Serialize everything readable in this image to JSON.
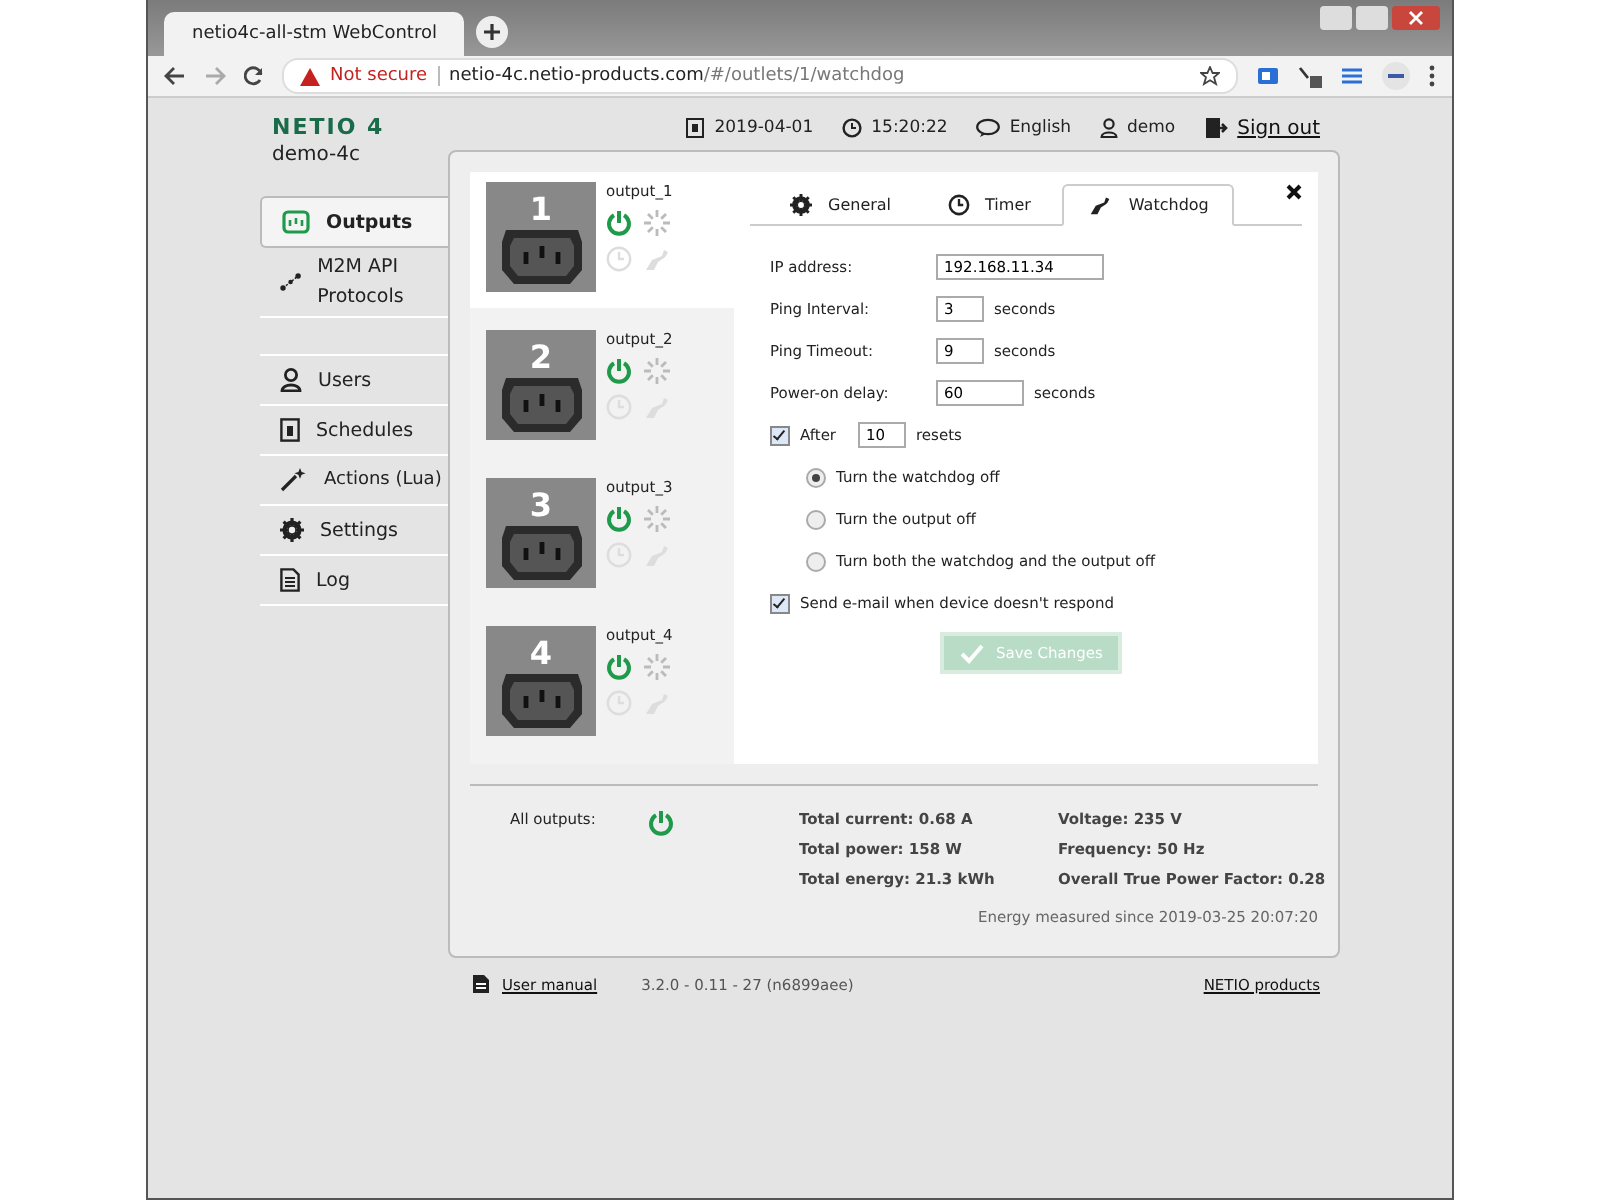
{
  "browser": {
    "tab_title": "netio4c-all-stm WebControl",
    "security": "Not secure",
    "host": "netio-4c.netio-products.com",
    "path": "/#/outlets/1/watchdog"
  },
  "header": {
    "logo": "NETIO 4",
    "device": "demo-4c",
    "date": "2019-04-01",
    "time": "15:20:22",
    "language": "English",
    "user": "demo",
    "sign_out": "Sign out"
  },
  "sidebar": {
    "items": [
      {
        "label": "Outputs",
        "kind": "outputs",
        "selected": true
      },
      {
        "label": "M2M API Protocols",
        "kind": "m2m",
        "selected": false
      },
      {
        "label": "Users",
        "kind": "users",
        "selected": false
      },
      {
        "label": "Schedules",
        "kind": "schedules",
        "selected": false
      },
      {
        "label": "Actions (Lua)",
        "kind": "actions",
        "selected": false
      },
      {
        "label": "Settings",
        "kind": "settings",
        "selected": false
      },
      {
        "label": "Log",
        "kind": "log",
        "selected": false
      }
    ]
  },
  "outputs": [
    {
      "number": "1",
      "name": "output_1",
      "selected": true,
      "on": true
    },
    {
      "number": "2",
      "name": "output_2",
      "selected": false,
      "on": true
    },
    {
      "number": "3",
      "name": "output_3",
      "selected": false,
      "on": true
    },
    {
      "number": "4",
      "name": "output_4",
      "selected": false,
      "on": true
    }
  ],
  "tabs": [
    {
      "label": "General",
      "kind": "general",
      "selected": false
    },
    {
      "label": "Timer",
      "kind": "timer",
      "selected": false
    },
    {
      "label": "Watchdog",
      "kind": "watchdog",
      "selected": true
    }
  ],
  "form": {
    "fields": [
      {
        "label": "IP address:",
        "value": "192.168.11.34",
        "kind": "wide"
      },
      {
        "label": "Ping Interval:",
        "value": "3",
        "unit": "seconds",
        "kind": "short"
      },
      {
        "label": "Ping Timeout:",
        "value": "9",
        "unit": "seconds",
        "kind": "short"
      },
      {
        "label": "Power-on delay:",
        "value": "60",
        "unit": "seconds",
        "kind": "medium"
      }
    ],
    "after": {
      "checked": true,
      "label": "After",
      "value": "10",
      "unit": "resets"
    },
    "radios": [
      {
        "label": "Turn the watchdog off",
        "selected": true
      },
      {
        "label": "Turn the output off",
        "selected": false
      },
      {
        "label": "Turn both the watchdog and the output off",
        "selected": false
      }
    ],
    "email": {
      "checked": true,
      "label": "Send e-mail when device doesn't respond"
    },
    "save_button": {
      "label": "Save Changes",
      "disabled": true
    }
  },
  "summary": {
    "all_outputs_label": "All outputs:",
    "all_on": true,
    "stats_left": [
      "Total current: 0.68 A",
      "Total power: 158 W",
      "Total energy: 21.3 kWh"
    ],
    "stats_right": [
      "Voltage: 235 V",
      "Frequency: 50 Hz",
      "Overall True Power Factor: 0.28"
    ],
    "energy_since": "Energy measured since 2019-03-25 20:07:20"
  },
  "footer": {
    "manual": "User manual",
    "version": "3.2.0 - 0.11 - 27 (n6899aee)",
    "products": "NETIO products"
  }
}
